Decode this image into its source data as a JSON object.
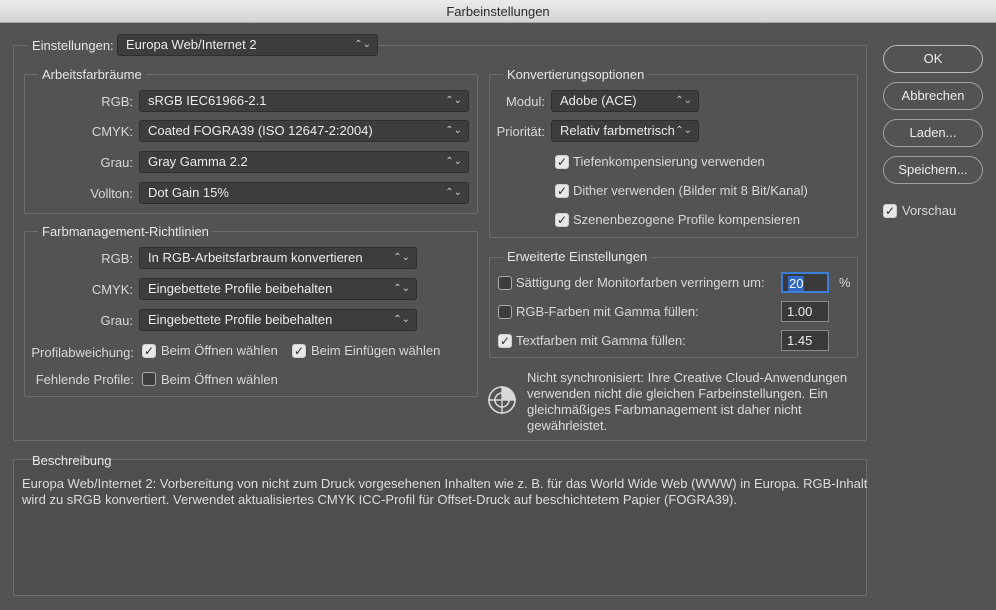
{
  "window": {
    "title": "Farbeinstellungen"
  },
  "settings": {
    "label": "Einstellungen:",
    "value": "Europa Web/Internet 2"
  },
  "workspaces": {
    "title": "Arbeitsfarbräume",
    "rgb_label": "RGB:",
    "rgb_value": "sRGB IEC61966-2.1",
    "cmyk_label": "CMYK:",
    "cmyk_value": "Coated FOGRA39 (ISO 12647-2:2004)",
    "gray_label": "Grau:",
    "gray_value": "Gray Gamma 2.2",
    "spot_label": "Vollton:",
    "spot_value": "Dot Gain 15%"
  },
  "policies": {
    "title": "Farbmanagement-Richtlinien",
    "rgb_label": "RGB:",
    "rgb_value": "In RGB-Arbeitsfarbraum konvertieren",
    "cmyk_label": "CMYK:",
    "cmyk_value": "Eingebettete Profile beibehalten",
    "gray_label": "Grau:",
    "gray_value": "Eingebettete Profile beibehalten",
    "mismatch_label": "Profilabweichung:",
    "mismatch_open": {
      "label": "Beim Öffnen wählen",
      "checked": true
    },
    "mismatch_paste": {
      "label": "Beim Einfügen wählen",
      "checked": true
    },
    "missing_label": "Fehlende Profile:",
    "missing_open": {
      "label": "Beim Öffnen wählen",
      "checked": false
    }
  },
  "conversion": {
    "title": "Konvertierungsoptionen",
    "engine_label": "Modul:",
    "engine_value": "Adobe (ACE)",
    "intent_label": "Priorität:",
    "intent_value": "Relativ farbmetrisch",
    "bpc": {
      "label": "Tiefenkompensierung verwenden",
      "checked": true
    },
    "dither": {
      "label": "Dither verwenden (Bilder mit 8 Bit/Kanal)",
      "checked": true
    },
    "scene": {
      "label": "Szenenbezogene Profile kompensieren",
      "checked": true
    }
  },
  "advanced": {
    "title": "Erweiterte Einstellungen",
    "desaturate": {
      "label": "Sättigung der Monitorfarben verringern um:",
      "checked": false,
      "value": "20",
      "unit": "%"
    },
    "blend_rgb": {
      "label": "RGB-Farben mit Gamma füllen:",
      "checked": false,
      "value": "1.00"
    },
    "blend_text": {
      "label": "Textfarben mit Gamma füllen:",
      "checked": true,
      "value": "1.45"
    }
  },
  "sync": {
    "line1": "Nicht synchronisiert: Ihre Creative Cloud-Anwendungen",
    "line2": "verwenden nicht die gleichen Farbeinstellungen. Ein",
    "line3": "gleichmäßiges Farbmanagement ist daher nicht",
    "line4": "gewährleistet."
  },
  "description": {
    "title": "Beschreibung",
    "line1": "Europa Web/Internet 2:  Vorbereitung von nicht zum Druck vorgesehenen Inhalten wie z. B. für das World Wide Web (WWW) in Europa. RGB-Inhalt",
    "line2": "wird zu sRGB konvertiert. Verwendet aktualisiertes CMYK ICC-Profil für Offset-Druck auf beschichtetem Papier (FOGRA39)."
  },
  "buttons": {
    "ok": "OK",
    "cancel": "Abbrechen",
    "load": "Laden...",
    "save": "Speichern..."
  },
  "preview": {
    "label": "Vorschau",
    "checked": true
  },
  "icons": {
    "chevron": "chevron-updown-icon",
    "check": "check-icon",
    "sync": "sync-warning-icon"
  }
}
